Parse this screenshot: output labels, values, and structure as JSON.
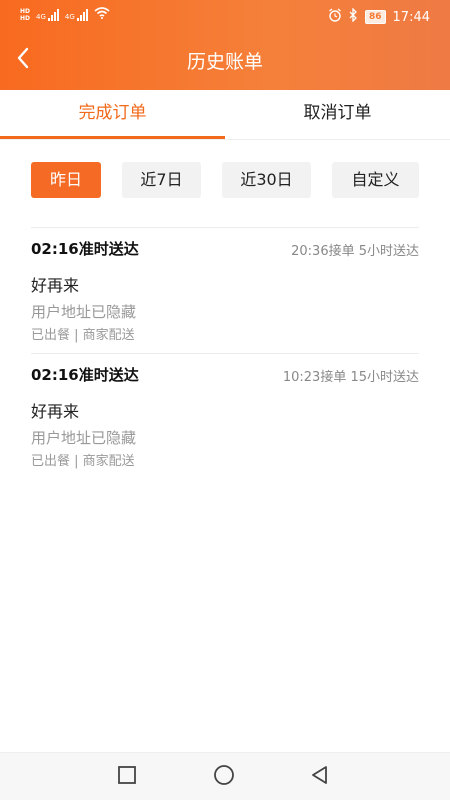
{
  "status_bar": {
    "network_label": "4G",
    "hd_label": "HD",
    "battery": "86",
    "time": "17:44"
  },
  "header": {
    "title": "历史账单"
  },
  "tabs": [
    {
      "label": "完成订单",
      "active": true
    },
    {
      "label": "取消订单",
      "active": false
    }
  ],
  "filters": [
    {
      "label": "昨日",
      "active": true
    },
    {
      "label": "近7日",
      "active": false
    },
    {
      "label": "近30日",
      "active": false
    },
    {
      "label": "自定义",
      "active": false
    }
  ],
  "orders": [
    {
      "delivery_time": "02:16准时送达",
      "accept_info": "20:36接单 5小时送达",
      "shop": "好再来",
      "address": "用户地址已隐藏",
      "status": "已出餐 | 商家配送"
    },
    {
      "delivery_time": "02:16准时送达",
      "accept_info": "10:23接单 15小时送达",
      "shop": "好再来",
      "address": "用户地址已隐藏",
      "status": "已出餐 | 商家配送"
    }
  ],
  "colors": {
    "accent": "#f26a1b",
    "header_start": "#f86a1f",
    "header_end": "#ef7a44",
    "muted_text": "#999999"
  },
  "icons": {
    "back": "chevron-left-icon",
    "nav_recent": "square-icon",
    "nav_home": "circle-icon",
    "nav_back": "triangle-left-icon"
  }
}
